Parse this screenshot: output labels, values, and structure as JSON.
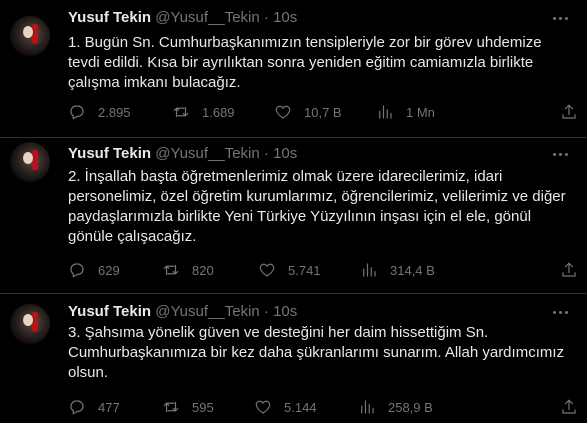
{
  "tweets": [
    {
      "name": "Yusuf Tekin",
      "handle": "@Yusuf__Tekin",
      "dot": "·",
      "time": "10s",
      "text": "1. Bugün Sn. Cumhurbaşkanımızın tensipleriyle zor bir görev uhdemize tevdi edildi. Kısa bir ayrılıktan sonra yeniden eğitim camiamızla birlikte çalışma imkanı bulacağız.",
      "replies": "2.895",
      "retweets": "1.689",
      "likes": "10,7 B",
      "views": "1 Mn"
    },
    {
      "name": "Yusuf Tekin",
      "handle": "@Yusuf__Tekin",
      "dot": "·",
      "time": "10s",
      "text": "2. İnşallah başta öğretmenlerimiz olmak üzere idarecilerimiz, idari personelimiz, özel öğretim kurumlarımız, öğrencilerimiz, velilerimiz ve diğer paydaşlarımızla birlikte Yeni Türkiye Yüzyılının inşası için el ele, gönül gönüle çalışacağız.",
      "replies": "629",
      "retweets": "820",
      "likes": "5.741",
      "views": "314,4 B"
    },
    {
      "name": "Yusuf Tekin",
      "handle": "@Yusuf__Tekin",
      "dot": "·",
      "time": "10s",
      "text": "3. Şahsıma yönelik güven ve desteğini her daim hissettiğim Sn. Cumhurbaşkanımıza bir kez daha şükranlarımı sunarım. Allah yardımcımız olsun.",
      "replies": "477",
      "retweets": "595",
      "likes": "5.144",
      "views": "258,9 B"
    }
  ],
  "icons": [
    "reply-icon",
    "retweet-icon",
    "like-icon",
    "views-icon",
    "share-icon",
    "more-icon"
  ]
}
